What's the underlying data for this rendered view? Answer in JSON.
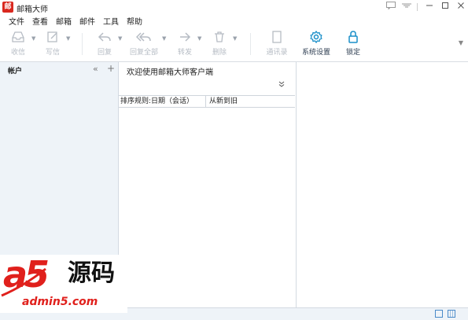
{
  "app": {
    "logo_text": "邮",
    "title": "邮箱大师"
  },
  "menu": [
    "文件",
    "查看",
    "邮箱",
    "邮件",
    "工具",
    "帮助"
  ],
  "toolbar": {
    "receive": "收信",
    "compose": "写信",
    "reply": "回复",
    "reply_all": "回复全部",
    "forward": "转发",
    "delete": "删除",
    "contacts": "通讯录",
    "settings": "系统设置",
    "lock": "锁定"
  },
  "left_panel": {
    "title": "帐户",
    "collapse": "«",
    "add": "+"
  },
  "mid_panel": {
    "welcome": "欢迎使用邮箱大师客户端",
    "sort_rule": "排序规则:日期（会话）",
    "sort_order": "从新到旧"
  },
  "watermark": {
    "brand": "a5",
    "cn": "源码",
    "url": "admin5.com"
  },
  "colors": {
    "accent": "#1a8fc9",
    "disabled": "#b6bcc4",
    "panel_bg": "#eef3f8",
    "brand_red": "#d9281f"
  }
}
